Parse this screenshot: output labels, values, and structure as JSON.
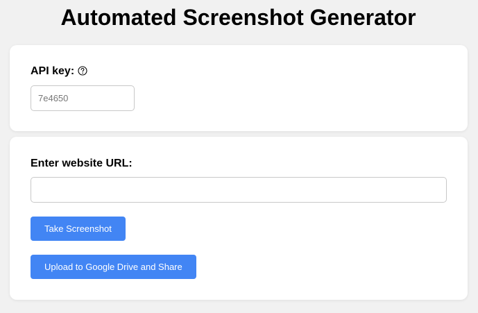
{
  "page": {
    "title": "Automated Screenshot Generator"
  },
  "api_card": {
    "label": "API key:",
    "help_icon": "question-circle-icon",
    "input_placeholder": "7e4650",
    "input_value": ""
  },
  "url_card": {
    "label": "Enter website URL:",
    "input_placeholder": "",
    "input_value": "",
    "take_screenshot_label": "Take Screenshot",
    "upload_label": "Upload to Google Drive and Share"
  },
  "colors": {
    "background": "#f1f1f1",
    "card": "#ffffff",
    "button": "#4285f4",
    "button_text": "#ffffff"
  }
}
